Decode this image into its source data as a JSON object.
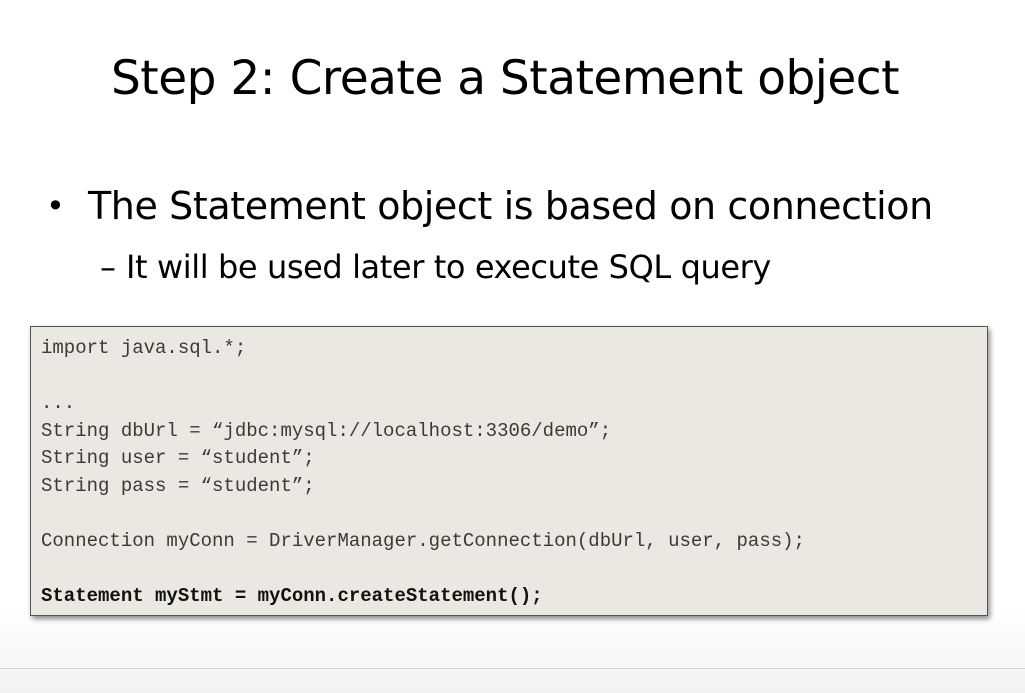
{
  "slide": {
    "title": "Step 2: Create a Statement object",
    "bullet": {
      "marker": "•",
      "text": "The Statement object is based on connection"
    },
    "subbullet": {
      "marker": "–",
      "text": "It will be used later to execute SQL query"
    },
    "code": {
      "background_color": "#ebe8e1",
      "lines": [
        "import java.sql.*;",
        "",
        "...",
        "String dbUrl = “jdbc:mysql://localhost:3306/demo”;",
        "String user = “student”;",
        "String pass = “student”;",
        "",
        "Connection myConn = DriverManager.getConnection(dbUrl, user, pass);",
        "",
        "Statement myStmt = myConn.createStatement();"
      ]
    }
  }
}
